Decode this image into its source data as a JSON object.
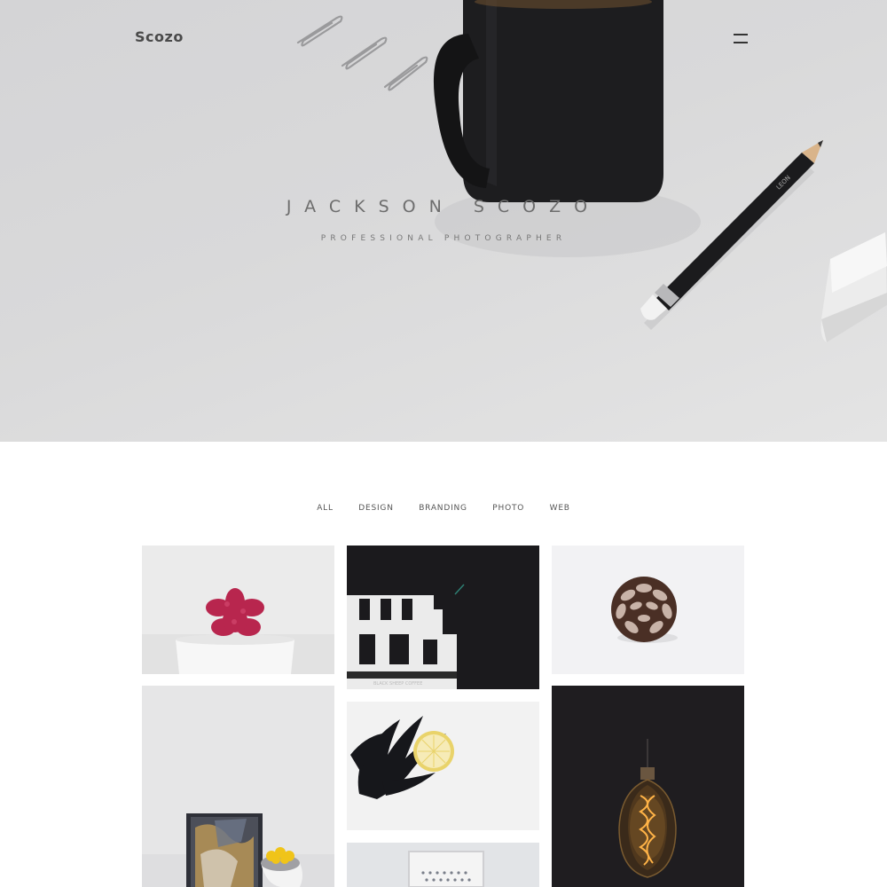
{
  "header": {
    "logo": "Scozo",
    "menu_icon": "hamburger-icon"
  },
  "hero": {
    "title": "JACKSON SCOZO",
    "subtitle": "PROFESSIONAL PHOTOGRAPHER",
    "pencil_label": "LEON"
  },
  "portfolio": {
    "filters": [
      "ALL",
      "DESIGN",
      "BRANDING",
      "PHOTO",
      "WEB"
    ],
    "items": [
      {
        "subject": "red succulent in white pot"
      },
      {
        "subject": "white building facade at night",
        "caption": "BLACK SHEEP COFFEE"
      },
      {
        "subject": "pine cone on white"
      },
      {
        "subject": "abstract canvas and yellow flowers"
      },
      {
        "subject": "black feathers and lemon slice"
      },
      {
        "subject": "edison light bulb on dark"
      },
      {
        "subject": "framed dotted artwork"
      }
    ]
  },
  "colors": {
    "hero_bg": "#d8d8d9",
    "page_bg": "#ffffff",
    "text_dark": "#4a4a4a",
    "text_muted": "#6d6d6d"
  }
}
